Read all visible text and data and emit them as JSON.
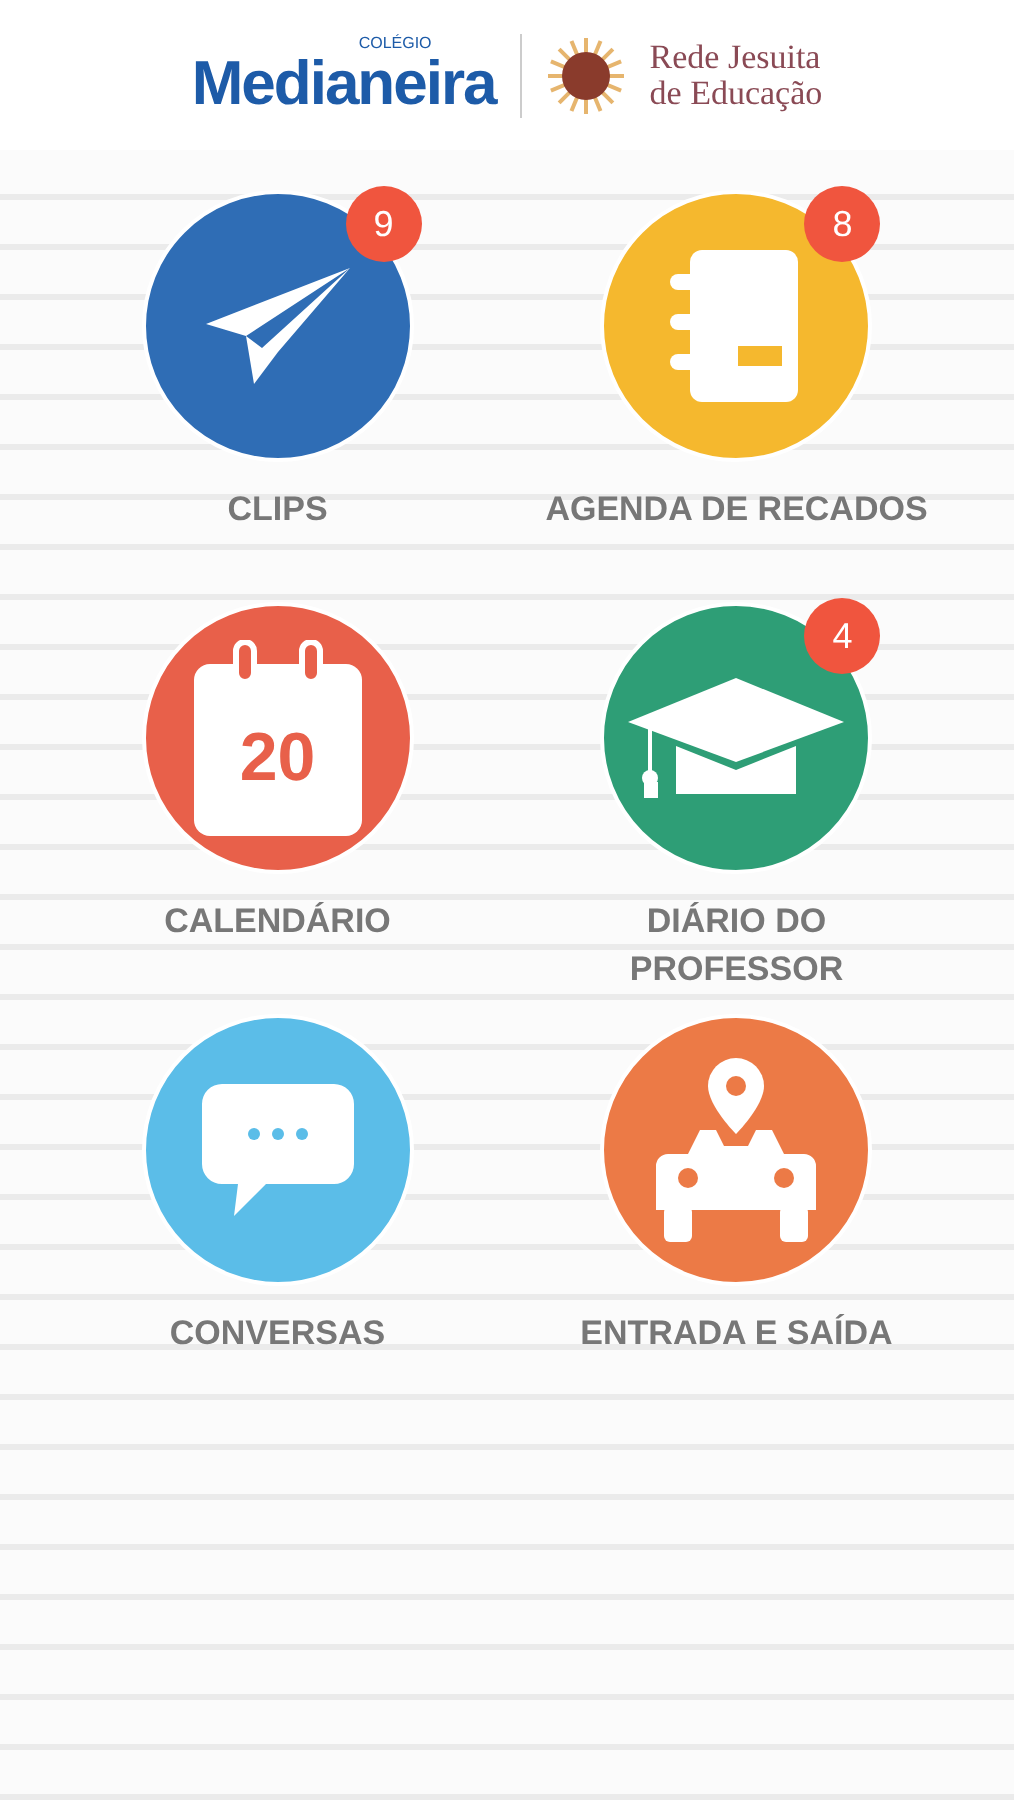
{
  "header": {
    "logo_small": "COLÉGIO",
    "logo_name": "Medianeira",
    "partner_line1": "Rede Jesuita",
    "partner_line2": "de Educação"
  },
  "menu": [
    {
      "label": "CLIPS",
      "kind": "plane",
      "color": "#2f6db5",
      "badge": "9"
    },
    {
      "label": "AGENDA DE RECADOS",
      "kind": "notebook",
      "color": "#f5b82e",
      "badge": "8"
    },
    {
      "label": "CALENDÁRIO",
      "kind": "calendar",
      "color": "#e8604a",
      "icon_text": "20"
    },
    {
      "label": "DIÁRIO DO\nPROFESSOR",
      "kind": "cap",
      "color": "#2e9e76",
      "badge": "4"
    },
    {
      "label": "CONVERSAS",
      "kind": "chat",
      "color": "#5bbde8"
    },
    {
      "label": "ENTRADA E SAÍDA",
      "kind": "car",
      "color": "#ec7a46"
    }
  ]
}
